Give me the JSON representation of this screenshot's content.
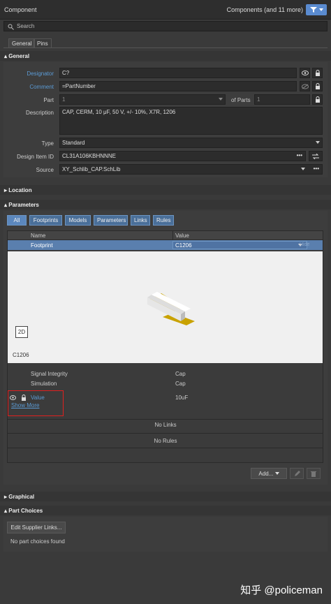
{
  "header": {
    "title": "Component",
    "count_label": "Components (and 11 more)"
  },
  "search": {
    "placeholder": "Search"
  },
  "tabs": [
    {
      "label": "General"
    },
    {
      "label": "Pins"
    }
  ],
  "general": {
    "section_label": "General",
    "designator": {
      "label": "Designator",
      "value": "C?"
    },
    "comment": {
      "label": "Comment",
      "value": "=PartNumber"
    },
    "part": {
      "label": "Part",
      "value": "1",
      "of_parts_label": "of Parts",
      "of_parts_value": "1"
    },
    "description": {
      "label": "Description",
      "value": "CAP, CERM, 10 μF, 50 V, +/- 10%, X7R, 1206"
    },
    "type": {
      "label": "Type",
      "value": "Standard"
    },
    "design_item_id": {
      "label": "Design Item ID",
      "value": "CL31A106KBHNNNE"
    },
    "source": {
      "label": "Source",
      "value": "XY_Schlib_CAP.SchLib"
    }
  },
  "location": {
    "section_label": "Location"
  },
  "parameters": {
    "section_label": "Parameters",
    "filters": [
      "All",
      "Footprints",
      "Models",
      "Parameters",
      "Links",
      "Rules"
    ],
    "columns": {
      "name": "Name",
      "value": "Value"
    },
    "footprint_row": {
      "name": "Footprint",
      "value": "C1206",
      "hide": "Hide"
    },
    "preview": {
      "mode_button": "2D",
      "footprint_label": "C1206"
    },
    "model_rows": [
      {
        "name": "Signal Integrity",
        "value": "Cap"
      },
      {
        "name": "Simulation",
        "value": "Cap"
      }
    ],
    "value_row": {
      "name": "Value",
      "value": "10uF"
    },
    "show_more": "Show More",
    "no_links": "No Links",
    "no_rules": "No Rules",
    "add_button": "Add..."
  },
  "graphical": {
    "section_label": "Graphical"
  },
  "part_choices": {
    "section_label": "Part Choices",
    "edit_button": "Edit Supplier Links...",
    "empty_text": "No part choices found"
  },
  "watermark": "知乎 @policeman",
  "colors": {
    "accent": "#5b9bd5",
    "selected_row": "#5a7fae",
    "highlight_box": "#e0201f",
    "pad_gold": "#c8a000"
  }
}
